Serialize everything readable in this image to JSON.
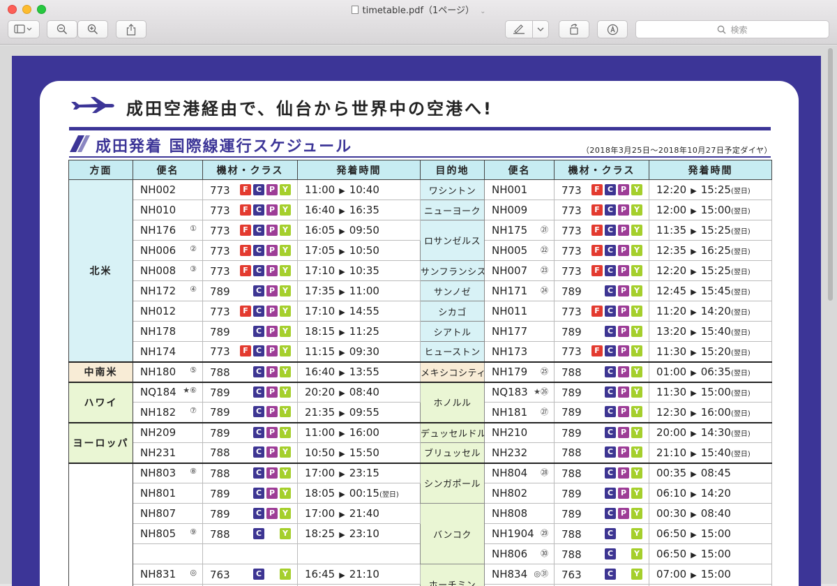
{
  "window": {
    "title": "timetable.pdf（1ページ）",
    "search_placeholder": "検索"
  },
  "document": {
    "headline": "成田空港経由で、仙台から世界中の空港へ!",
    "subheading": "成田発着 国際線運行スケジュール",
    "validity": "（2018年3月25日〜2018年10月27日予定ダイヤ）",
    "headers": [
      "方面",
      "便名",
      "機材・クラス",
      "発着時間",
      "目的地",
      "便名",
      "機材・クラス",
      "発着時間"
    ],
    "class_colors": {
      "F": "#e33a2f",
      "C": "#3d3592",
      "P": "#9d3d96",
      "Y": "#a5cf2c"
    },
    "rows": [
      {
        "region": "北米",
        "out": {
          "flight": "NH002",
          "mark": "",
          "eq": "773",
          "cls": "FCPY",
          "dep": "11:00",
          "arr": "10:40",
          "note": ""
        },
        "dest": "ワシントン",
        "in": {
          "flight": "NH001",
          "mark": "",
          "eq": "773",
          "cls": "FCPY",
          "dep": "12:20",
          "arr": "15:25",
          "note": "(翌日)"
        }
      },
      {
        "region": "",
        "out": {
          "flight": "NH010",
          "mark": "",
          "eq": "773",
          "cls": "FCPY",
          "dep": "16:40",
          "arr": "16:35",
          "note": ""
        },
        "dest": "ニューヨーク",
        "in": {
          "flight": "NH009",
          "mark": "",
          "eq": "773",
          "cls": "FCPY",
          "dep": "12:00",
          "arr": "15:00",
          "note": "(翌日)"
        }
      },
      {
        "region": "",
        "out": {
          "flight": "NH176",
          "mark": "①",
          "eq": "773",
          "cls": "FCPY",
          "dep": "16:05",
          "arr": "09:50",
          "note": ""
        },
        "dest": "ロサンゼルス",
        "in": {
          "flight": "NH175",
          "mark": "㉑",
          "eq": "773",
          "cls": "FCPY",
          "dep": "11:35",
          "arr": "15:25",
          "note": "(翌日)"
        }
      },
      {
        "region": "",
        "out": {
          "flight": "NH006",
          "mark": "②",
          "eq": "773",
          "cls": "FCPY",
          "dep": "17:05",
          "arr": "10:50",
          "note": ""
        },
        "dest": "",
        "in": {
          "flight": "NH005",
          "mark": "㉒",
          "eq": "773",
          "cls": "FCPY",
          "dep": "12:35",
          "arr": "16:25",
          "note": "(翌日)"
        }
      },
      {
        "region": "",
        "out": {
          "flight": "NH008",
          "mark": "③",
          "eq": "773",
          "cls": "FCPY",
          "dep": "17:10",
          "arr": "10:35",
          "note": ""
        },
        "dest": "サンフランシスコ",
        "in": {
          "flight": "NH007",
          "mark": "㉓",
          "eq": "773",
          "cls": "FCPY",
          "dep": "12:20",
          "arr": "15:25",
          "note": "(翌日)"
        }
      },
      {
        "region": "",
        "out": {
          "flight": "NH172",
          "mark": "④",
          "eq": "789",
          "cls": "CPY",
          "dep": "17:35",
          "arr": "11:00",
          "note": ""
        },
        "dest": "サンノゼ",
        "in": {
          "flight": "NH171",
          "mark": "㉔",
          "eq": "789",
          "cls": "CPY",
          "dep": "12:45",
          "arr": "15:45",
          "note": "(翌日)"
        }
      },
      {
        "region": "",
        "out": {
          "flight": "NH012",
          "mark": "",
          "eq": "773",
          "cls": "FCPY",
          "dep": "17:10",
          "arr": "14:55",
          "note": ""
        },
        "dest": "シカゴ",
        "in": {
          "flight": "NH011",
          "mark": "",
          "eq": "773",
          "cls": "FCPY",
          "dep": "11:20",
          "arr": "14:20",
          "note": "(翌日)"
        }
      },
      {
        "region": "",
        "out": {
          "flight": "NH178",
          "mark": "",
          "eq": "789",
          "cls": "CPY",
          "dep": "18:15",
          "arr": "11:25",
          "note": ""
        },
        "dest": "シアトル",
        "in": {
          "flight": "NH177",
          "mark": "",
          "eq": "789",
          "cls": "CPY",
          "dep": "13:20",
          "arr": "15:40",
          "note": "(翌日)"
        }
      },
      {
        "region": "",
        "out": {
          "flight": "NH174",
          "mark": "",
          "eq": "773",
          "cls": "FCPY",
          "dep": "11:15",
          "arr": "09:30",
          "note": ""
        },
        "dest": "ヒューストン",
        "in": {
          "flight": "NH173",
          "mark": "",
          "eq": "773",
          "cls": "FCPY",
          "dep": "11:30",
          "arr": "15:20",
          "note": "(翌日)"
        }
      },
      {
        "region": "中南米",
        "out": {
          "flight": "NH180",
          "mark": "⑤",
          "eq": "788",
          "cls": "CPY",
          "dep": "16:40",
          "arr": "13:55",
          "note": ""
        },
        "dest": "メキシコシティ",
        "in": {
          "flight": "NH179",
          "mark": "㉕",
          "eq": "788",
          "cls": "CPY",
          "dep": "01:00",
          "arr": "06:35",
          "note": "(翌日)"
        }
      },
      {
        "region": "ハワイ",
        "out": {
          "flight": "NQ184",
          "mark": "★⑥",
          "eq": "789",
          "cls": "CPY",
          "dep": "20:20",
          "arr": "08:40",
          "note": ""
        },
        "dest": "ホノルル",
        "in": {
          "flight": "NQ183",
          "mark": "★㉖",
          "eq": "789",
          "cls": "CPY",
          "dep": "11:30",
          "arr": "15:00",
          "note": "(翌日)"
        }
      },
      {
        "region": "",
        "out": {
          "flight": "NH182",
          "mark": "⑦",
          "eq": "789",
          "cls": "CPY",
          "dep": "21:35",
          "arr": "09:55",
          "note": ""
        },
        "dest": "",
        "in": {
          "flight": "NH181",
          "mark": "㉗",
          "eq": "789",
          "cls": "CPY",
          "dep": "12:30",
          "arr": "16:00",
          "note": "(翌日)"
        }
      },
      {
        "region": "ヨーロッパ",
        "out": {
          "flight": "NH209",
          "mark": "",
          "eq": "789",
          "cls": "CPY",
          "dep": "11:00",
          "arr": "16:00",
          "note": ""
        },
        "dest": "デュッセルドルフ",
        "in": {
          "flight": "NH210",
          "mark": "",
          "eq": "789",
          "cls": "CPY",
          "dep": "20:00",
          "arr": "14:30",
          "note": "(翌日)"
        }
      },
      {
        "region": "",
        "out": {
          "flight": "NH231",
          "mark": "",
          "eq": "788",
          "cls": "CPY",
          "dep": "10:50",
          "arr": "15:50",
          "note": ""
        },
        "dest": "ブリュッセル",
        "in": {
          "flight": "NH232",
          "mark": "",
          "eq": "788",
          "cls": "CPY",
          "dep": "21:10",
          "arr": "15:40",
          "note": "(翌日)"
        }
      },
      {
        "region": "",
        "out": {
          "flight": "NH803",
          "mark": "⑧",
          "eq": "788",
          "cls": "CPY",
          "dep": "17:00",
          "arr": "23:15",
          "note": ""
        },
        "dest": "シンガポール",
        "in": {
          "flight": "NH804",
          "mark": "㉘",
          "eq": "788",
          "cls": "CPY",
          "dep": "00:35",
          "arr": "08:45",
          "note": ""
        }
      },
      {
        "region": "",
        "out": {
          "flight": "NH801",
          "mark": "",
          "eq": "789",
          "cls": "CPY",
          "dep": "18:05",
          "arr": "00:15",
          "note": "(翌日)"
        },
        "dest": "",
        "in": {
          "flight": "NH802",
          "mark": "",
          "eq": "789",
          "cls": "CPY",
          "dep": "06:10",
          "arr": "14:20",
          "note": ""
        }
      },
      {
        "region": "",
        "out": {
          "flight": "NH807",
          "mark": "",
          "eq": "789",
          "cls": "CPY",
          "dep": "17:00",
          "arr": "21:40",
          "note": ""
        },
        "dest": "バンコク",
        "in": {
          "flight": "NH808",
          "mark": "",
          "eq": "789",
          "cls": "CPY",
          "dep": "00:30",
          "arr": "08:40",
          "note": ""
        }
      },
      {
        "region": "",
        "out": {
          "flight": "NH805",
          "mark": "⑨",
          "eq": "788",
          "cls": "CY",
          "dep": "18:25",
          "arr": "23:10",
          "note": ""
        },
        "dest": "",
        "in": {
          "flight": "NH1904",
          "mark": "㉙",
          "eq": "788",
          "cls": "CY",
          "dep": "06:50",
          "arr": "15:00",
          "note": ""
        }
      },
      {
        "region": "",
        "out": {
          "flight": "",
          "mark": "",
          "eq": "",
          "cls": "",
          "dep": "",
          "arr": "",
          "note": ""
        },
        "dest": "",
        "in": {
          "flight": "NH806",
          "mark": "㉚",
          "eq": "788",
          "cls": "CY",
          "dep": "06:50",
          "arr": "15:00",
          "note": ""
        }
      },
      {
        "region": "",
        "out": {
          "flight": "NH831",
          "mark": "◎",
          "eq": "763",
          "cls": "CY",
          "dep": "16:45",
          "arr": "21:10",
          "note": ""
        },
        "dest": "ホーチミン",
        "in": {
          "flight": "NH834",
          "mark": "◎㉛",
          "eq": "763",
          "cls": "CY",
          "dep": "07:00",
          "arr": "15:00",
          "note": ""
        }
      },
      {
        "region": "",
        "out": {
          "flight": "",
          "mark": "",
          "eq": "",
          "cls": "",
          "dep": "",
          "arr": "",
          "note": ""
        },
        "dest": "",
        "in": {
          "flight": "",
          "mark": "",
          "eq": "",
          "cls": "",
          "dep": "",
          "arr": "",
          "note": ""
        }
      }
    ]
  }
}
